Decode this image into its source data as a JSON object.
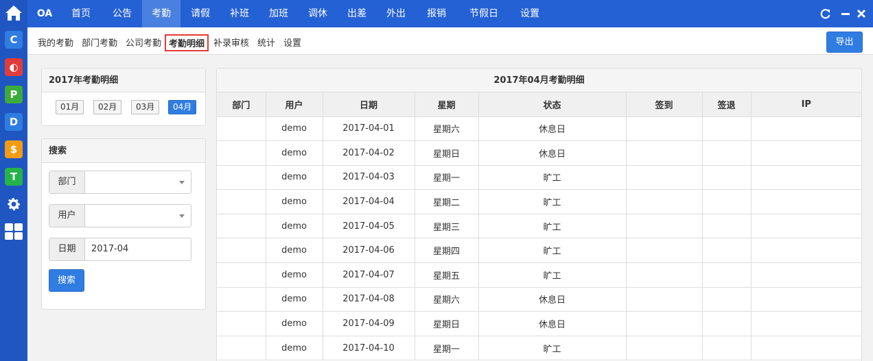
{
  "nav": {
    "brand": "OA",
    "items": [
      "首页",
      "公告",
      "考勤",
      "请假",
      "补班",
      "加班",
      "调休",
      "出差",
      "外出",
      "报销",
      "节假日",
      "设置"
    ],
    "active_index": 2
  },
  "subnav": {
    "items": [
      "我的考勤",
      "部门考勤",
      "公司考勤",
      "考勤明细",
      "补录审核",
      "统计",
      "设置"
    ],
    "active_index": 3,
    "export_label": "导出"
  },
  "rail_apps": [
    {
      "letter": "C",
      "color": "#2f7de1"
    },
    {
      "letter": "◐",
      "color": "#e23b3b"
    },
    {
      "letter": "P",
      "color": "#3cab3c"
    },
    {
      "letter": "D",
      "color": "#2f7de1"
    },
    {
      "letter": "$",
      "color": "#f39c12"
    },
    {
      "letter": "T",
      "color": "#25b34a"
    }
  ],
  "year_panel": {
    "title": "2017年考勤明细",
    "months": [
      "01月",
      "02月",
      "03月",
      "04月"
    ],
    "active_month_index": 3
  },
  "search_panel": {
    "title": "搜索",
    "dept_label": "部门",
    "dept_value": "",
    "user_label": "用户",
    "user_value": "",
    "date_label": "日期",
    "date_value": "2017-04",
    "search_label": "搜索"
  },
  "table": {
    "title": "2017年04月考勤明细",
    "headers": [
      "部门",
      "用户",
      "日期",
      "星期",
      "状态",
      "签到",
      "签退",
      "IP"
    ],
    "rows": [
      [
        "",
        "demo",
        "2017-04-01",
        "星期六",
        "休息日",
        "",
        "",
        ""
      ],
      [
        "",
        "demo",
        "2017-04-02",
        "星期日",
        "休息日",
        "",
        "",
        ""
      ],
      [
        "",
        "demo",
        "2017-04-03",
        "星期一",
        "旷工",
        "",
        "",
        ""
      ],
      [
        "",
        "demo",
        "2017-04-04",
        "星期二",
        "旷工",
        "",
        "",
        ""
      ],
      [
        "",
        "demo",
        "2017-04-05",
        "星期三",
        "旷工",
        "",
        "",
        ""
      ],
      [
        "",
        "demo",
        "2017-04-06",
        "星期四",
        "旷工",
        "",
        "",
        ""
      ],
      [
        "",
        "demo",
        "2017-04-07",
        "星期五",
        "旷工",
        "",
        "",
        ""
      ],
      [
        "",
        "demo",
        "2017-04-08",
        "星期六",
        "休息日",
        "",
        "",
        ""
      ],
      [
        "",
        "demo",
        "2017-04-09",
        "星期日",
        "休息日",
        "",
        "",
        ""
      ],
      [
        "",
        "demo",
        "2017-04-10",
        "星期一",
        "旷工",
        "",
        "",
        ""
      ]
    ]
  },
  "colors": {
    "topbar": "#2461d4",
    "rail": "#1f56c2",
    "active_nav": "#4a80e0",
    "primary": "#2f7de1",
    "highlight_border": "#e53935"
  }
}
